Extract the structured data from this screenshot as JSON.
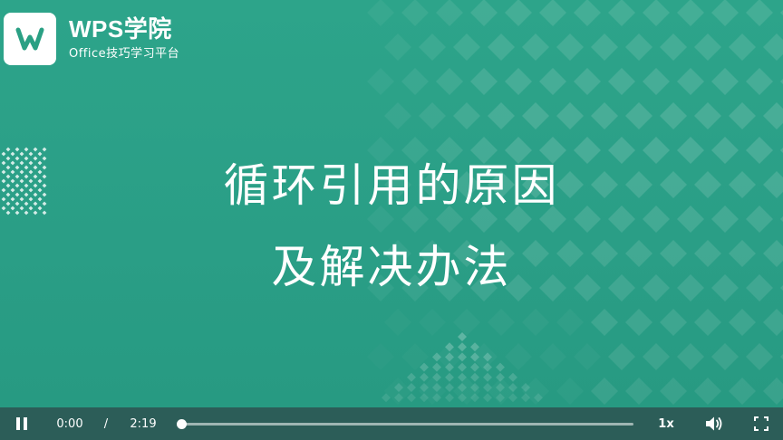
{
  "brand": {
    "title": "WPS学院",
    "subtitle": "Office技巧学习平台",
    "logo_icon": "wps-w-logo-icon"
  },
  "slide": {
    "title_line1": "循环引用的原因",
    "title_line2": "及解决办法"
  },
  "player": {
    "play_state_icon": "pause-icon",
    "current_time": "0:00",
    "separator": "/",
    "duration": "2:19",
    "progress_fraction": 0.005,
    "speed": "1x",
    "volume_icon": "volume-icon",
    "fullscreen_icon": "fullscreen-icon"
  },
  "colors": {
    "slide_bg": "#2ba087",
    "control_bar": "#2c5d58",
    "logo_green": "#2aa084",
    "text": "#ffffff"
  }
}
